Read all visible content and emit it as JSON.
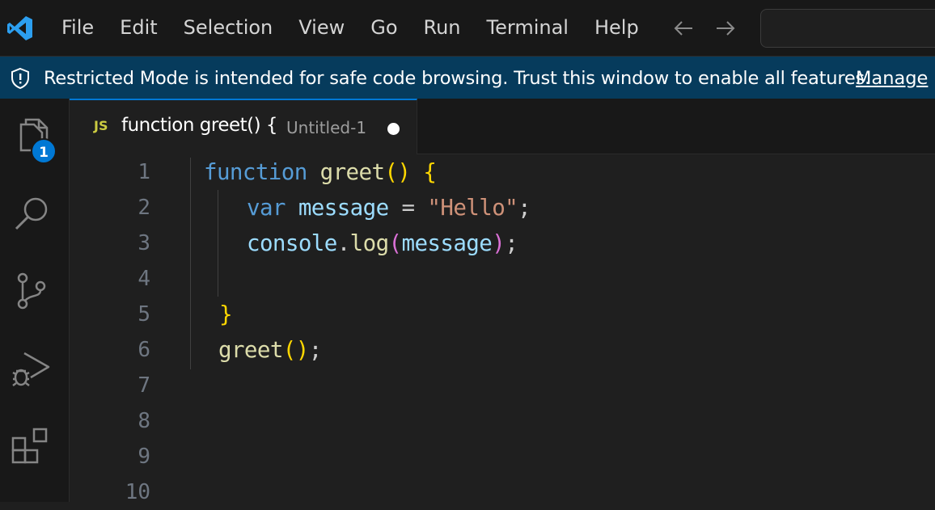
{
  "menu": {
    "items": [
      "File",
      "Edit",
      "Selection",
      "View",
      "Go",
      "Run",
      "Terminal",
      "Help"
    ]
  },
  "banner": {
    "text": "Restricted Mode is intended for safe code browsing. Trust this window to enable all features.",
    "link": "Manage"
  },
  "activity_bar": {
    "explorer_badge": "1",
    "icons": [
      "files-icon",
      "search-icon",
      "source-control-icon",
      "run-debug-icon",
      "extensions-icon"
    ]
  },
  "tab": {
    "lang_icon": "JS",
    "title": "function greet() {",
    "description": "Untitled-1",
    "dirty": true
  },
  "editor": {
    "line_numbers": [
      "1",
      "2",
      "3",
      "4",
      "5",
      "6",
      "7",
      "8",
      "9",
      "10"
    ],
    "lines": [
      [
        {
          "t": "kw",
          "v": "function"
        },
        {
          "t": "pl",
          "v": " "
        },
        {
          "t": "fn",
          "v": "greet"
        },
        {
          "t": "br1",
          "v": "()"
        },
        {
          "t": "pl",
          "v": " "
        },
        {
          "t": "br1",
          "v": "{"
        }
      ],
      [
        {
          "t": "kw",
          "v": "var"
        },
        {
          "t": "pl",
          "v": " "
        },
        {
          "t": "var",
          "v": "message"
        },
        {
          "t": "pl",
          "v": " = "
        },
        {
          "t": "str",
          "v": "\"Hello\""
        },
        {
          "t": "pl",
          "v": ";"
        }
      ],
      [
        {
          "t": "var",
          "v": "console"
        },
        {
          "t": "pl",
          "v": "."
        },
        {
          "t": "fn",
          "v": "log"
        },
        {
          "t": "br2",
          "v": "("
        },
        {
          "t": "var",
          "v": "message"
        },
        {
          "t": "br2",
          "v": ")"
        },
        {
          "t": "pl",
          "v": ";"
        }
      ],
      [],
      [
        {
          "t": "br1",
          "v": "}"
        }
      ],
      [
        {
          "t": "fn",
          "v": "greet"
        },
        {
          "t": "br1",
          "v": "()"
        },
        {
          "t": "pl",
          "v": ";"
        }
      ]
    ]
  },
  "colors": {
    "accent": "#0078d4",
    "banner_bg": "#063b5c",
    "editor_bg": "#1f1f1f",
    "keyword": "#569cd6",
    "function": "#dcdcaa",
    "variable": "#9cdcfe",
    "string": "#ce9178",
    "bracket1": "#ffd700",
    "bracket2": "#da70d6"
  }
}
